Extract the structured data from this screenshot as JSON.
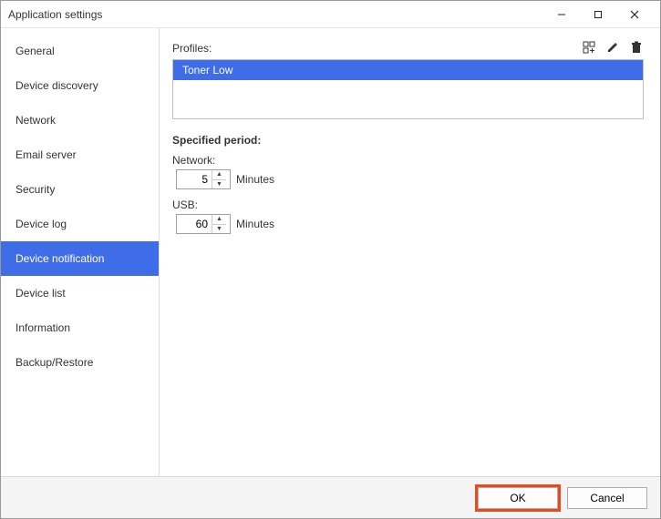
{
  "window": {
    "title": "Application settings"
  },
  "sidebar": {
    "items": [
      {
        "label": "General"
      },
      {
        "label": "Device discovery"
      },
      {
        "label": "Network"
      },
      {
        "label": "Email server"
      },
      {
        "label": "Security"
      },
      {
        "label": "Device log"
      },
      {
        "label": "Device notification"
      },
      {
        "label": "Device list"
      },
      {
        "label": "Information"
      },
      {
        "label": "Backup/Restore"
      }
    ],
    "active_index": 6
  },
  "profiles": {
    "label": "Profiles:",
    "items": [
      {
        "name": "Toner Low"
      }
    ]
  },
  "period": {
    "title": "Specified period:",
    "network": {
      "label": "Network:",
      "value": "5",
      "unit": "Minutes"
    },
    "usb": {
      "label": "USB:",
      "value": "60",
      "unit": "Minutes"
    }
  },
  "footer": {
    "ok": "OK",
    "cancel": "Cancel"
  }
}
